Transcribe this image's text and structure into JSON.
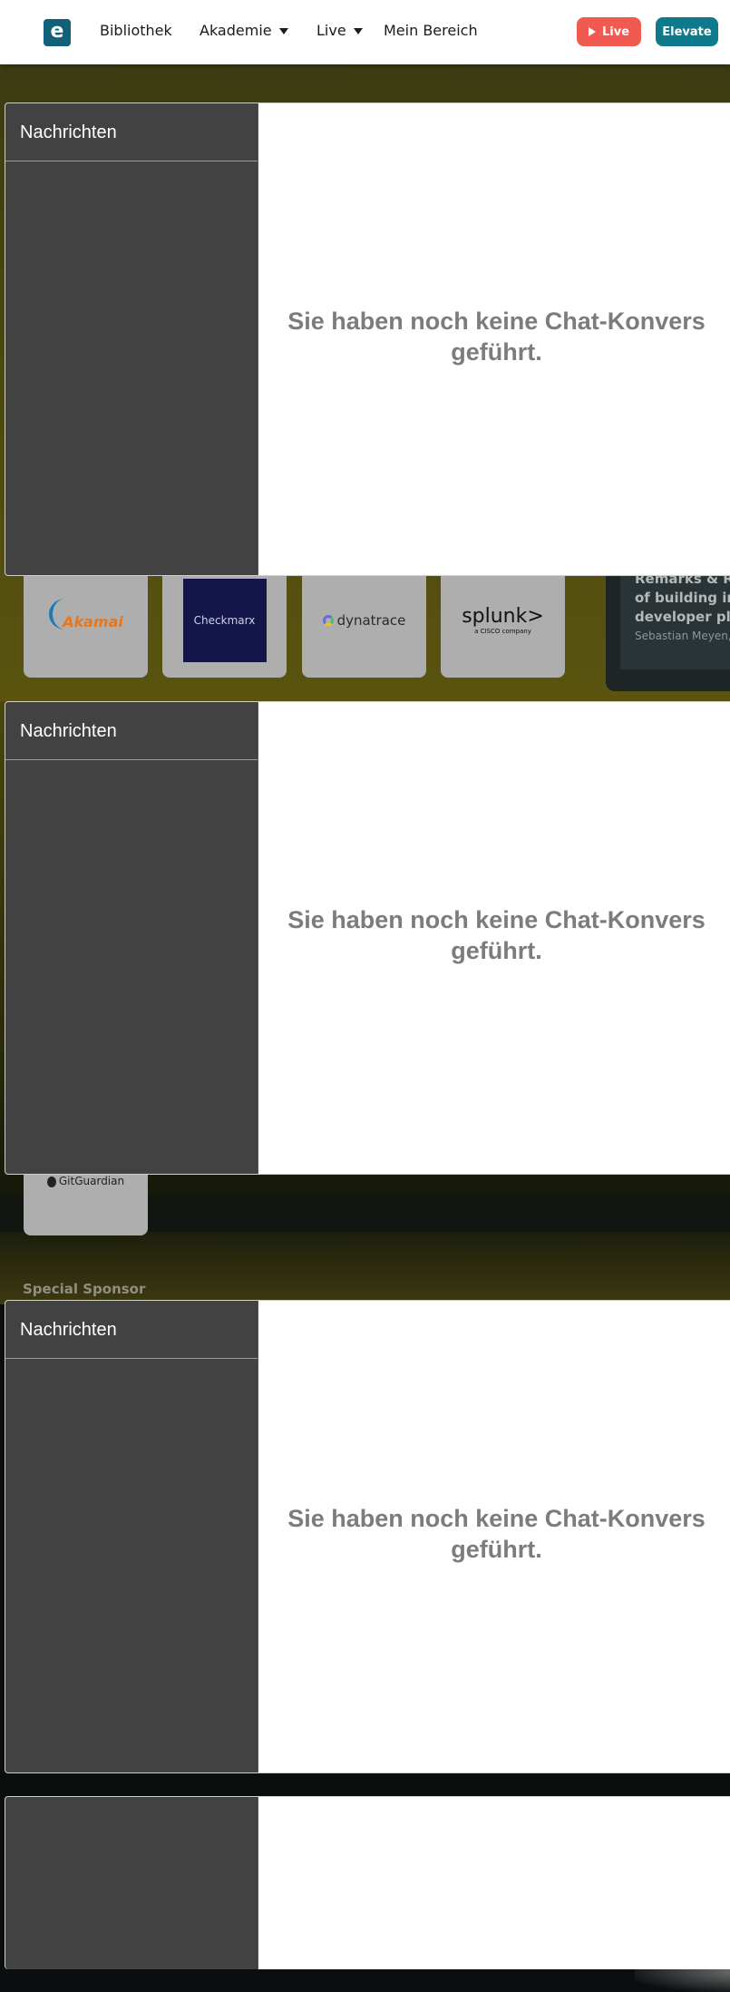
{
  "header": {
    "logo_letter": "e",
    "nav": {
      "bibliothek": "Bibliothek",
      "akademie": "Akademie",
      "live": "Live",
      "mein_bereich": "Mein Bereich"
    },
    "live_button": "Live",
    "elevate_button": "Elevate"
  },
  "sponsors": {
    "row": [
      {
        "name": "Akamai",
        "label": "Akamai"
      },
      {
        "name": "Checkmarx",
        "label": "Checkmarx"
      },
      {
        "name": "Dynatrace",
        "label": "dynatrace"
      },
      {
        "name": "Splunk",
        "label": "splunk>",
        "sub": "a CISCO company"
      }
    ],
    "second_row_label": "GitGuardian",
    "special_sponsor_label": "Special Sponsor"
  },
  "talk_card": {
    "title_lines": [
      "Remarks & Ro",
      "of building int",
      "developer pla"
    ],
    "speaker": "Sebastian Meyen, ..."
  },
  "chat_panels": [
    {
      "sidebar_title": "Nachrichten",
      "empty_line1": "Sie haben noch keine Chat-Konvers",
      "empty_line2": "geführt."
    },
    {
      "sidebar_title": "Nachrichten",
      "empty_line1": "Sie haben noch keine Chat-Konvers",
      "empty_line2": "geführt."
    },
    {
      "sidebar_title": "Nachrichten",
      "empty_line1": "Sie haben noch keine Chat-Konvers",
      "empty_line2": "geführt."
    }
  ],
  "colors": {
    "brand": "#10607a",
    "live_button": "#f05a50",
    "elevate_button": "#0f7a8b",
    "chat_sidebar": "#424242"
  }
}
